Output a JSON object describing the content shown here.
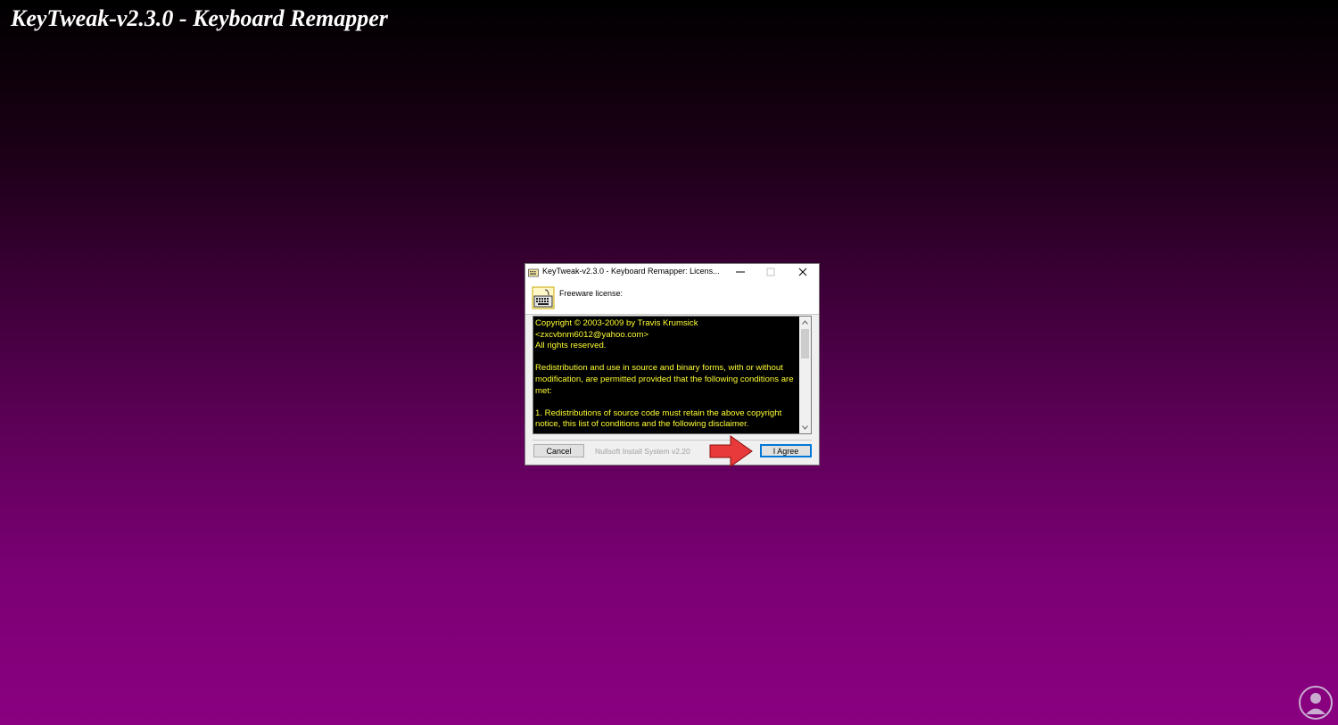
{
  "page": {
    "title": "KeyTweak-v2.3.0 - Keyboard Remapper"
  },
  "dialog": {
    "title": "KeyTweak-v2.3.0 - Keyboard Remapper: Licens...",
    "header_text": "Freeware license:",
    "license_text": "Copyright © 2003-2009 by Travis Krumsick\n<zxcvbnm6012@yahoo.com>\nAll rights reserved.\n\nRedistribution and use in source and binary forms, with or without modification, are permitted provided that the following conditions are met:\n\n1. Redistributions of source code must retain the above copyright notice, this list of conditions and the following disclaimer.",
    "cancel_label": "Cancel",
    "system_label": "Nullsoft Install System v2.20",
    "agree_label": "I Agree"
  },
  "icons": {
    "app": "keyboard-icon",
    "minimize": "minimize-icon",
    "maximize": "maximize-icon",
    "close": "close-icon",
    "scroll_up": "chevron-up-icon",
    "scroll_down": "chevron-down-icon",
    "arrow": "arrow-right-icon",
    "watermark": "logo-icon"
  },
  "colors": {
    "license_text": "#ffff33",
    "license_bg": "#000000",
    "agree_border": "#0078d7",
    "arrow": "#e83a3a"
  }
}
